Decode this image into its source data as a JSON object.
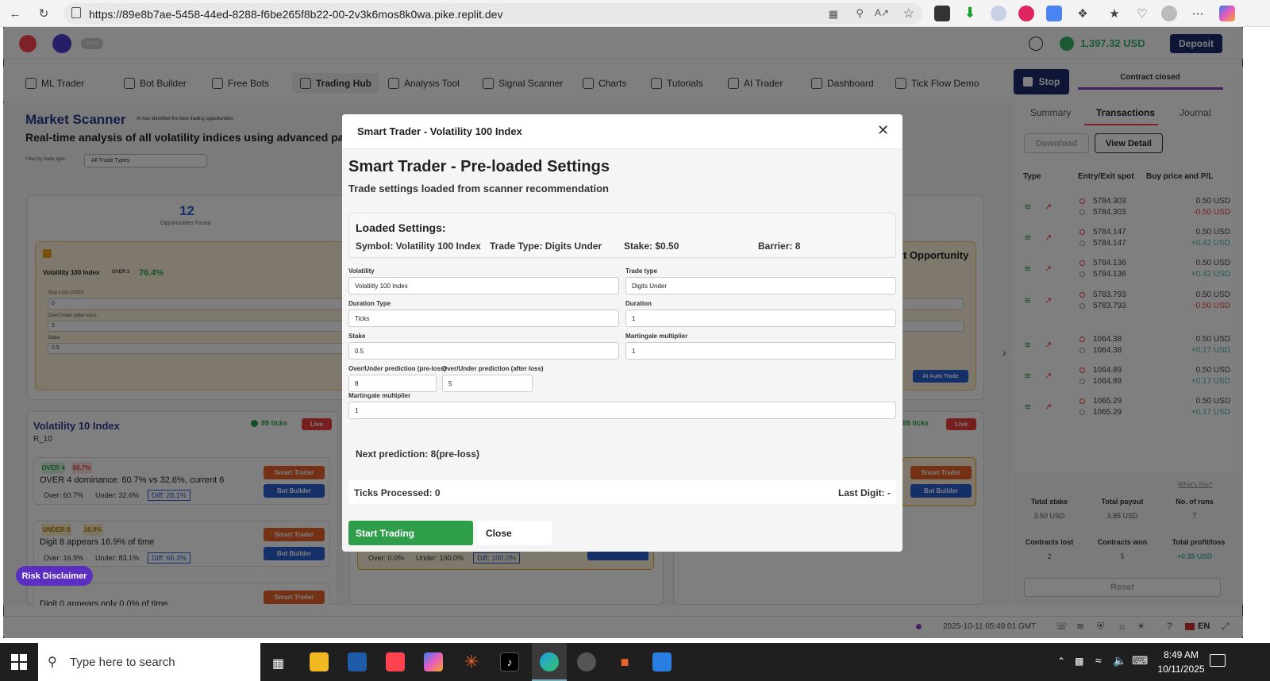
{
  "browser": {
    "url": "https://89e8b7ae-5458-44ed-8288-f6be265f8b22-00-2v3k6mos8k0wa.pike.replit.dev"
  },
  "topbar": {
    "toggle_label": "OFF",
    "balance": "1,397.32 USD",
    "deposit_label": "Deposit"
  },
  "nav": {
    "items": [
      {
        "label": "ML Trader"
      },
      {
        "label": "Bot Builder"
      },
      {
        "label": "Free Bots"
      },
      {
        "label": "Trading Hub"
      },
      {
        "label": "Analysis Tool"
      },
      {
        "label": "Signal Scanner"
      },
      {
        "label": "Charts"
      },
      {
        "label": "Tutorials"
      },
      {
        "label": "AI Trader"
      },
      {
        "label": "Dashboard"
      },
      {
        "label": "Tick Flow Demo"
      }
    ]
  },
  "scanner": {
    "title": "Market Scanner",
    "ai_badge": "AI has identified the best trading opportunities",
    "subtitle": "Real-time analysis of all volatility indices using advanced pattern",
    "filter_label": "Filter by trade type:",
    "filter_value": "All Trade Types",
    "opportunities_count": "12",
    "opportunities_label": "Opportunities Found",
    "best_symbol": "Volatility 100 Index",
    "best_badge": "OVER 3",
    "best_pct": "76.4%",
    "stop_loss_label": "Stop Loss (USD):",
    "stop_loss_value": "0",
    "after_loss_label": "Over/Under (after loss):",
    "after_loss_value": "5",
    "stake_label": "Stake:",
    "stake_value": "0.5",
    "opportunity_heading": "t Opportunity",
    "auto_trade_label": "AI Auto Trade",
    "card": {
      "title": "Volatility 10 Index",
      "code": "R_10",
      "ticks": "89 ticks",
      "live": "Live",
      "s1_tag": "OVER 4",
      "s1_pct": "60.7%",
      "s1_text": "OVER 4 dominance: 60.7% vs 32.6%, current 6",
      "s1_over": "Over: 60.7%",
      "s1_under": "Under: 32.6%",
      "s1_diff": "Diff: 28.1%",
      "s2_tag": "UNDER 8",
      "s2_pct": "16.9%",
      "s2_text": "Digit 8 appears 16.9% of time",
      "s2_over": "Over: 16.9%",
      "s2_under": "Under: 83.1%",
      "s2_diff": "Diff: 66.3%",
      "s3_text": "Digit 0 appears only 0.0% of time",
      "smart_trader": "Smart Trader",
      "bot_builder": "Bot Builder"
    },
    "card2": {
      "over": "Over: 0.0%",
      "under": "Under: 100.0%",
      "diff": "Diff: 100.0%"
    },
    "card3": {
      "ticks": "89 ticks",
      "live": "Live"
    }
  },
  "right_panel": {
    "stop_label": "Stop",
    "contract_status": "Contract closed",
    "tabs": [
      "Summary",
      "Transactions",
      "Journal"
    ],
    "download_label": "Download",
    "view_detail_label": "View Detail",
    "col_type": "Type",
    "col_entry": "Entry/Exit spot",
    "col_buy": "Buy price and P/L",
    "transactions": [
      {
        "entry": "5784.303",
        "exit": "5784.303",
        "buy": "0.50 USD",
        "pl": "-0.50 USD",
        "win": false
      },
      {
        "entry": "5784.147",
        "exit": "5784.147",
        "buy": "0.50 USD",
        "pl": "+0.42 USD",
        "win": true
      },
      {
        "entry": "5784.136",
        "exit": "5784.136",
        "buy": "0.50 USD",
        "pl": "+0.42 USD",
        "win": true
      },
      {
        "entry": "5783.793",
        "exit": "5783.793",
        "buy": "0.50 USD",
        "pl": "-0.50 USD",
        "win": false
      },
      {
        "entry": "1064.38",
        "exit": "1064.38",
        "buy": "0.50 USD",
        "pl": "+0.17 USD",
        "win": true
      },
      {
        "entry": "1064.89",
        "exit": "1064.89",
        "buy": "0.50 USD",
        "pl": "+0.17 USD",
        "win": true
      },
      {
        "entry": "1065.29",
        "exit": "1065.29",
        "buy": "0.50 USD",
        "pl": "+0.17 USD",
        "win": true
      }
    ],
    "whats_this": "What's this?",
    "total_stake_label": "Total stake",
    "total_stake": "3.50 USD",
    "total_payout_label": "Total payout",
    "total_payout": "3.85 USD",
    "runs_label": "No. of runs",
    "runs": "7",
    "lost_label": "Contracts lost",
    "lost": "2",
    "won_label": "Contracts won",
    "won": "5",
    "profit_label": "Total profit/loss",
    "profit": "+0.35 USD",
    "reset_label": "Reset"
  },
  "risk_disclaimer": "Risk Disclaimer",
  "modal": {
    "header": "Smart Trader - Volatility 100 Index",
    "title": "Smart Trader - Pre-loaded Settings",
    "subtitle": "Trade settings loaded from scanner recommendation",
    "loaded_heading": "Loaded Settings:",
    "symbol": "Symbol: Volatility 100 Index",
    "trade_type": "Trade Type: Digits Under",
    "stake": "Stake: $0.50",
    "barrier": "Barrier: 8",
    "fields": {
      "volatility_label": "Volatility",
      "volatility_value": "Volatility 100 Index",
      "trade_type_label": "Trade type",
      "trade_type_value": "Digits Under",
      "duration_type_label": "Duration Type",
      "duration_type_value": "Ticks",
      "duration_label": "Duration",
      "duration_value": "1",
      "stake_label": "Stake",
      "stake_value": "0.5",
      "martingale_label": "Martingale multiplier",
      "martingale_value": "1",
      "pre_loss_label": "Over/Under prediction (pre-loss)",
      "pre_loss_value": "8",
      "after_loss_label": "Over/Under prediction (after loss)",
      "after_loss_value": "5",
      "martingale2_label": "Martingale multiplier",
      "martingale2_value": "1"
    },
    "next_prediction": "Next prediction: 8(pre-loss)",
    "ticks_processed": "Ticks Processed: 0",
    "last_digit": "Last Digit: -",
    "start_label": "Start Trading",
    "close_label": "Close"
  },
  "footer": {
    "timestamp": "2025-10-11 05:49:01 GMT",
    "lang": "EN"
  },
  "taskbar": {
    "search_placeholder": "Type here to search",
    "time": "8:49 AM",
    "date": "10/11/2025"
  },
  "colors": {
    "brand_blue": "#2a3a8c",
    "deposit": "#1e2a6e",
    "start_green": "#2e9e4a",
    "profit_green": "#4bb4b3",
    "loss_red": "#ec3f3f",
    "smart_trader_orange": "#e8632a",
    "bot_builder_blue": "#2a5fd0",
    "disclaimer_purple": "#5a2fc2"
  }
}
